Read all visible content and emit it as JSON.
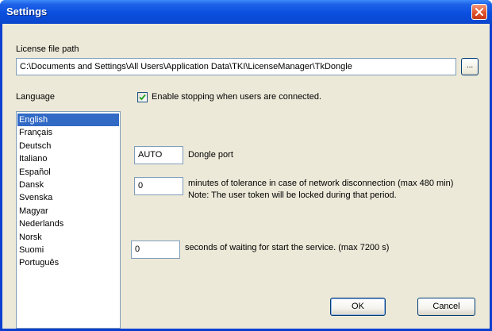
{
  "window": {
    "title": "Settings"
  },
  "license": {
    "label": "License file path",
    "path": "C:\\Documents and Settings\\All Users\\Application Data\\TKI\\LicenseManager\\TkDongle",
    "browse_label": "..."
  },
  "language": {
    "label": "Language",
    "options": [
      "English",
      "Français",
      "Deutsch",
      "Italiano",
      "Español",
      "Dansk",
      "Svenska",
      "Magyar",
      "Nederlands",
      "Norsk",
      "Suomi",
      "Português"
    ],
    "selected": "English"
  },
  "stopping": {
    "checked": true,
    "label": "Enable stopping when users are connected."
  },
  "dongle": {
    "value": "AUTO",
    "label": "Dongle port"
  },
  "tolerance": {
    "value": "0",
    "label": "minutes of tolerance in case of network disconnection (max 480 min)",
    "note": "Note: The user token will be locked during that period."
  },
  "waiting": {
    "value": "0",
    "label": "seconds of waiting for start the service. (max 7200 s)"
  },
  "buttons": {
    "ok": "OK",
    "cancel": "Cancel"
  }
}
